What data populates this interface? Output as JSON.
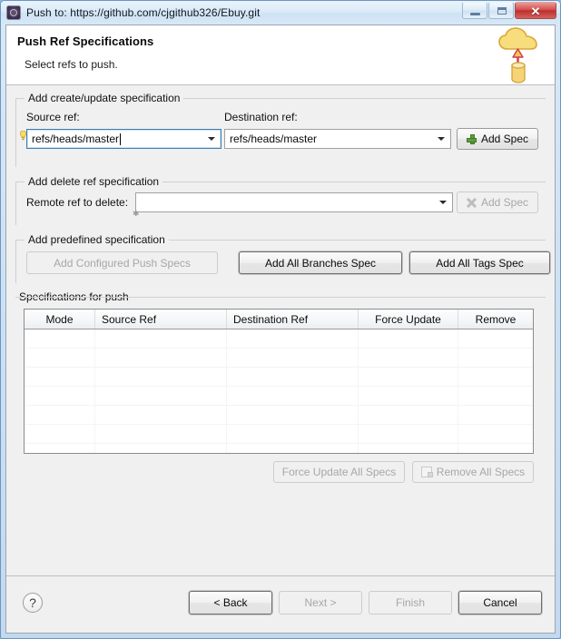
{
  "window": {
    "title": "Push to: https://github.com/cjgithub326/Ebuy.git",
    "app_icon": "git-gear-icon",
    "controls": {
      "minimize": "minimize-icon",
      "maximize": "maximize-icon",
      "close": "✕"
    }
  },
  "banner": {
    "title": "Push Ref Specifications",
    "subtitle": "Select refs to push.",
    "icon": "cloud-push-icon"
  },
  "create_update_group": {
    "legend": "Add create/update specification",
    "source_label": "Source ref:",
    "source_value": "refs/heads/master",
    "source_placeholder": "",
    "destination_label": "Destination ref:",
    "destination_value": "refs/heads/master",
    "destination_placeholder": "",
    "add_spec_label": "Add Spec",
    "add_spec_icon": "green-plus-icon",
    "add_spec_enabled": true
  },
  "delete_group": {
    "legend": "Add delete ref specification",
    "remote_label": "Remote ref to delete:",
    "remote_value": "",
    "remote_placeholder": "",
    "add_spec_label": "Add Spec",
    "add_spec_icon": "grey-x-icon",
    "add_spec_enabled": false
  },
  "predefined_group": {
    "legend": "Add predefined specification",
    "buttons": [
      {
        "label": "Add Configured Push Specs",
        "enabled": false
      },
      {
        "label": "Add All Branches Spec",
        "enabled": true
      },
      {
        "label": "Add All Tags Spec",
        "enabled": true
      }
    ]
  },
  "specs_group": {
    "legend": "Specifications for push",
    "columns": [
      "Mode",
      "Source Ref",
      "Destination Ref",
      "Force Update",
      "Remove"
    ],
    "rows": [],
    "empty_row_count": 7,
    "actions": [
      {
        "label": "Force Update All Specs",
        "enabled": false,
        "icon": ""
      },
      {
        "label": "Remove All Specs",
        "enabled": false,
        "icon": "remove-all-icon"
      }
    ]
  },
  "footer": {
    "help_label": "?",
    "buttons": [
      {
        "label": "< Back",
        "enabled": true,
        "default": true
      },
      {
        "label": "Next >",
        "enabled": false,
        "default": false
      },
      {
        "label": "Finish",
        "enabled": false,
        "default": false
      },
      {
        "label": "Cancel",
        "enabled": true,
        "default": false
      }
    ]
  },
  "colors": {
    "title_bar": "#d7e9f7",
    "dialog_bg": "#f0f0f0",
    "banner_bg": "#ffffff",
    "accent_green": "#5f9d3f",
    "close_red": "#bc2f2d",
    "focus_blue": "#3c7fb1",
    "cloud_yellow": "#f5d76e"
  }
}
